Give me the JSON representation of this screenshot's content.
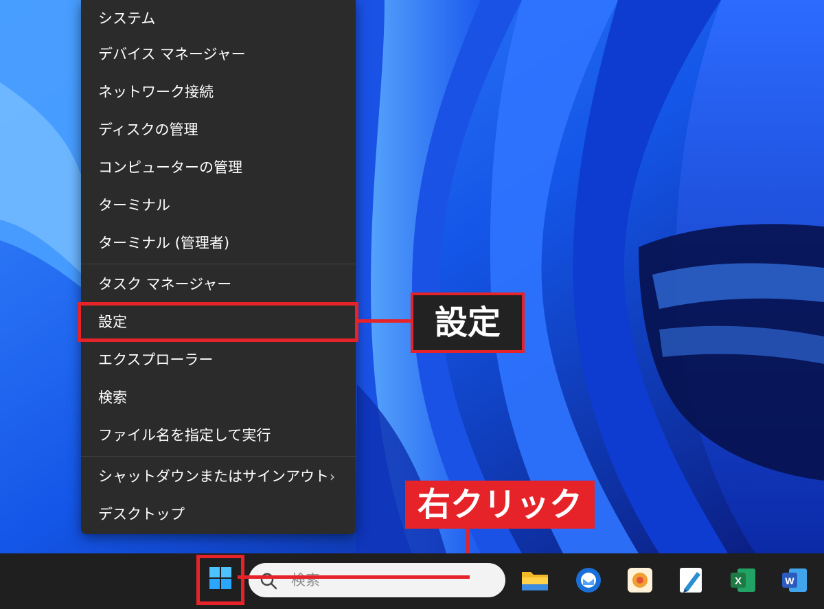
{
  "context_menu": {
    "items": [
      {
        "label": "システム"
      },
      {
        "label": "デバイス マネージャー"
      },
      {
        "label": "ネットワーク接続"
      },
      {
        "label": "ディスクの管理"
      },
      {
        "label": "コンピューターの管理"
      },
      {
        "label": "ターミナル"
      },
      {
        "label": "ターミナル (管理者)"
      },
      {
        "label": "タスク マネージャー"
      },
      {
        "label": "設定"
      },
      {
        "label": "エクスプローラー"
      },
      {
        "label": "検索"
      },
      {
        "label": "ファイル名を指定して実行"
      },
      {
        "label": "シャットダウンまたはサインアウト"
      },
      {
        "label": "デスクトップ"
      }
    ],
    "submenu_chevron": "›"
  },
  "annotations": {
    "settings_callout": "設定",
    "right_click_label": "右クリック",
    "highlight_color": "#e52329"
  },
  "taskbar": {
    "search_placeholder": "検索",
    "apps": [
      {
        "name": "file-explorer-icon",
        "color": "#f2b825"
      },
      {
        "name": "thunderbird-icon",
        "color": "#1a6fd8"
      },
      {
        "name": "photo-app-icon",
        "color": "#f0a030"
      },
      {
        "name": "pen-app-icon",
        "color": "#2a8fd0"
      },
      {
        "name": "excel-icon",
        "color": "#1d7a45",
        "glyph": "X"
      },
      {
        "name": "word-icon",
        "color": "#2b5bbf",
        "glyph": "W"
      }
    ]
  }
}
